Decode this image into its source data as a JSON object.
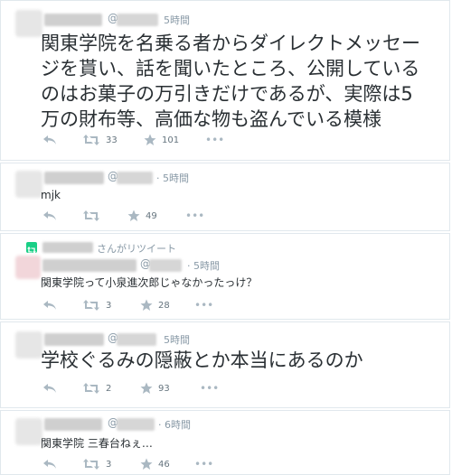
{
  "tweets": [
    {
      "at": "@",
      "time": "5時間",
      "lines": [
        "関東学院を名乗る者からダイレクトメッセー",
        "ジを貰い、話を聞いたところ、公開している",
        "のはお菓子の万引きだけであるが、実際は5",
        "万の財布等、高価な物も盗んでいる模様"
      ],
      "retweets": "33",
      "favorites": "101",
      "more": "•••"
    },
    {
      "at": "@",
      "time": "· 5時間",
      "text": "mjk",
      "retweets": "",
      "favorites": "49",
      "more": "•••"
    },
    {
      "retweeted_by": "さんがリツイート",
      "at": "@",
      "time": "· 5時間",
      "text": "関東学院って小泉進次郎じゃなかったっけ？",
      "retweets": "3",
      "favorites": "28",
      "more": "•••"
    },
    {
      "at": "@",
      "time": "5時間",
      "text": "学校ぐるみの隠蔽とか本当にあるのか",
      "retweets": "2",
      "favorites": "93",
      "more": "•••"
    },
    {
      "at": "@",
      "time": "· 6時間",
      "text": "関東学院 三春台ねぇ…",
      "retweets": "3",
      "favorites": "46",
      "more": "•••"
    }
  ],
  "colors": {
    "border": "#e1e8ed",
    "meta": "#8899a6",
    "text": "#292f33",
    "retweet_green": "#19cf86",
    "redacted": "#cfcfcf"
  },
  "icons": [
    "reply-icon",
    "retweet-icon",
    "favorite-star-icon",
    "more-dots-icon"
  ]
}
